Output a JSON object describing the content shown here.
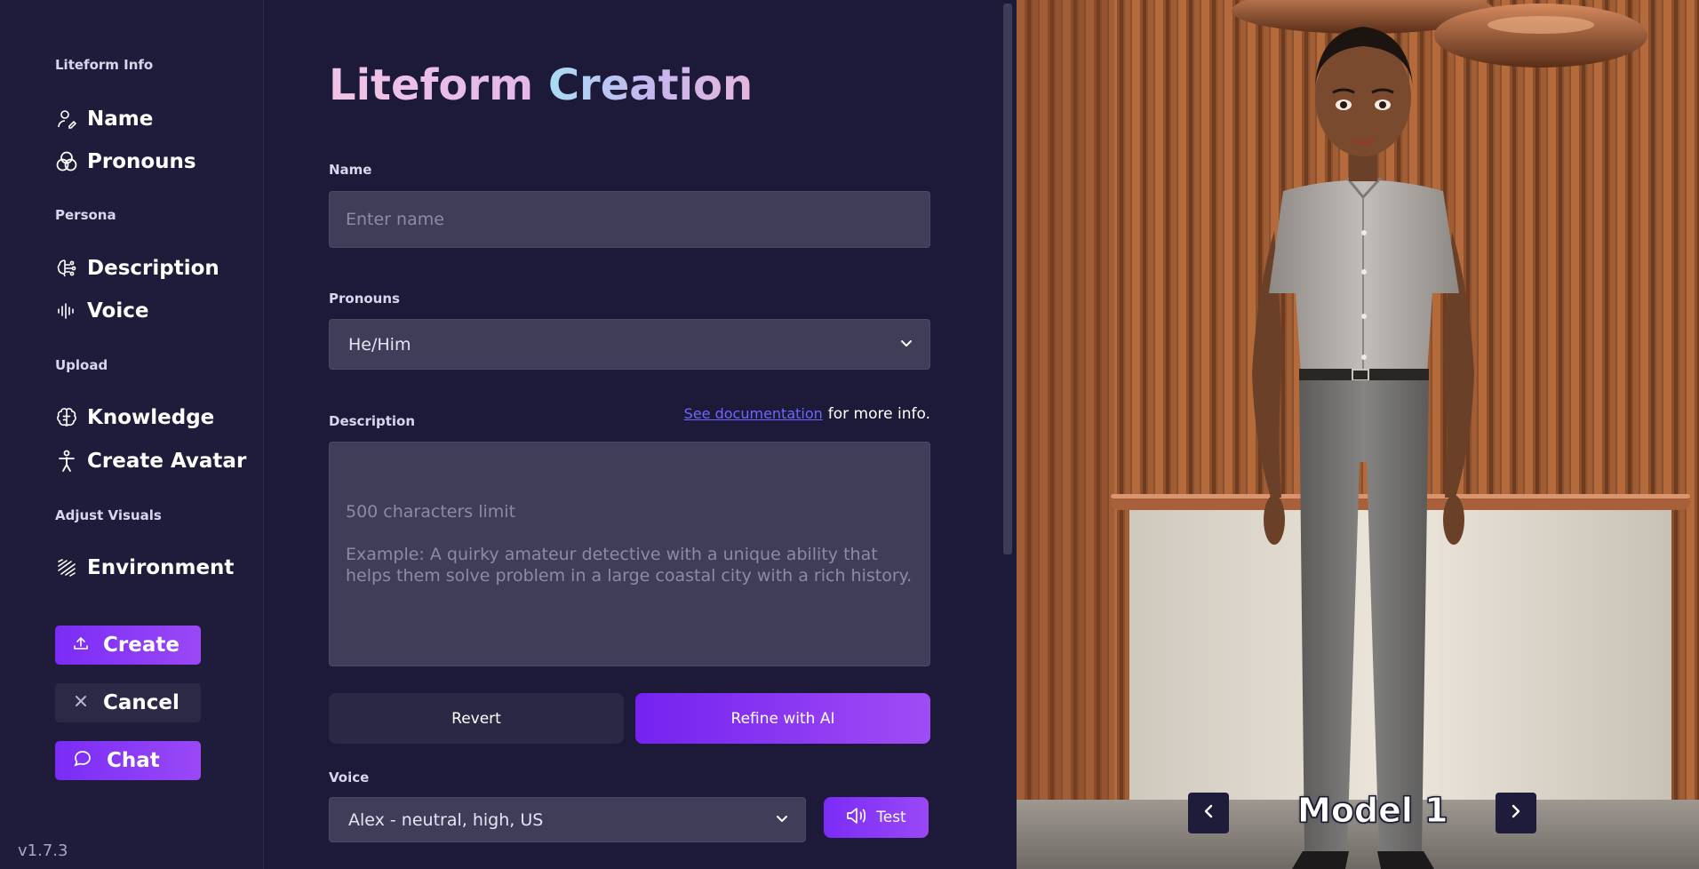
{
  "sidebar": {
    "sections": {
      "liteform_info": "Liteform Info",
      "persona": "Persona",
      "upload": "Upload",
      "adjust_visuals": "Adjust Visuals"
    },
    "items": {
      "name": "Name",
      "pronouns": "Pronouns",
      "description": "Description",
      "voice": "Voice",
      "knowledge": "Knowledge",
      "create_avatar": "Create Avatar",
      "environment": "Environment"
    },
    "buttons": {
      "create": "Create",
      "cancel": "Cancel",
      "chat": "Chat"
    },
    "version": "v1.7.3"
  },
  "main": {
    "title_part1": "Liteform",
    "title_part2": "Creation",
    "name": {
      "label": "Name",
      "placeholder": "Enter name",
      "value": ""
    },
    "pronouns": {
      "label": "Pronouns",
      "selected": "He/Him"
    },
    "description": {
      "label": "Description",
      "doc_link": "See documentation",
      "doc_suffix": "for more info.",
      "placeholder": "500 characters limit\n\nExample: A quirky amateur detective with a unique ability that helps them solve problem in a large coastal city with a rich history.",
      "value": ""
    },
    "buttons": {
      "revert": "Revert",
      "refine": "Refine with AI"
    },
    "voice": {
      "label": "Voice",
      "selected": "Alex - neutral, high, US",
      "test": "Test"
    }
  },
  "preview": {
    "model_label": "Model 1"
  },
  "colors": {
    "background": "#1c1a38",
    "sidebar": "#1e1c3a",
    "accent": "#7a2cf6",
    "input_bg": "#3f3d58",
    "link": "#6f66ff"
  }
}
